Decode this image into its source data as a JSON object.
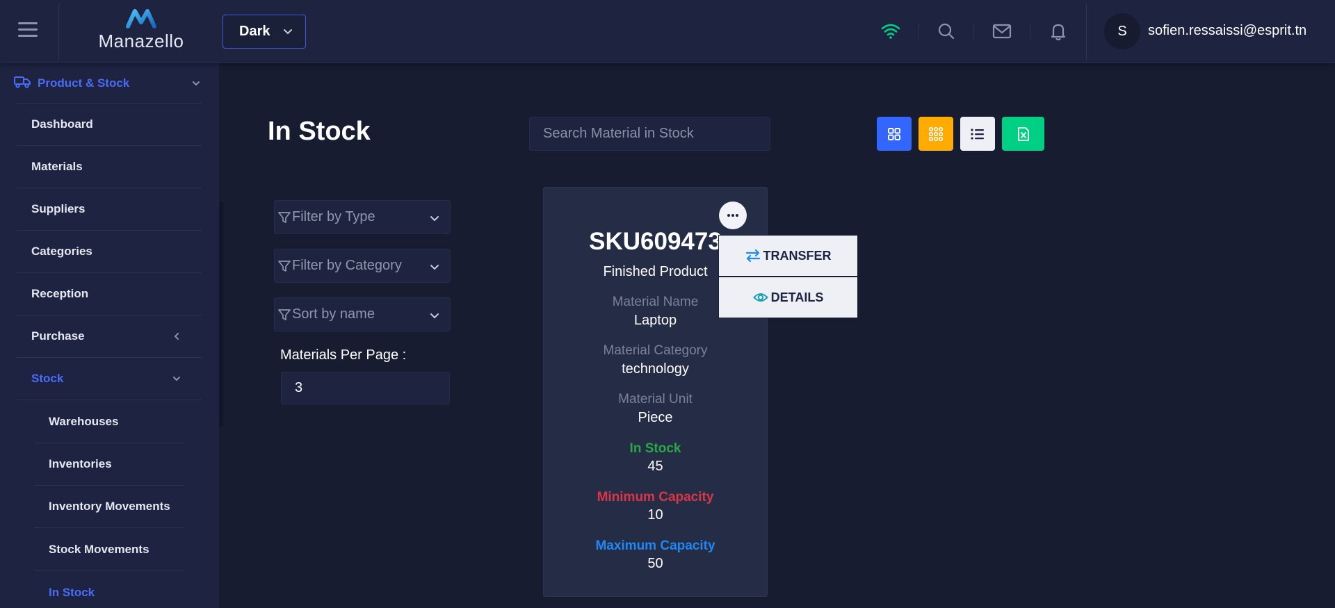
{
  "header": {
    "logo_text": "Manazello",
    "theme_select": "Dark",
    "user_initial": "S",
    "user_email": "sofien.ressaissi@esprit.tn"
  },
  "sidebar": {
    "section": "Product & Stock",
    "items": [
      {
        "label": "Dashboard"
      },
      {
        "label": "Materials"
      },
      {
        "label": "Suppliers"
      },
      {
        "label": "Categories"
      },
      {
        "label": "Reception"
      },
      {
        "label": "Purchase"
      },
      {
        "label": "Stock"
      }
    ],
    "stock_sub": [
      {
        "label": "Warehouses"
      },
      {
        "label": "Inventories"
      },
      {
        "label": "Inventory Movements"
      },
      {
        "label": "Stock Movements"
      },
      {
        "label": "In Stock"
      }
    ]
  },
  "main": {
    "title": "In Stock",
    "search_placeholder": "Search Material in Stock",
    "filters": {
      "type": "Filter by Type",
      "category": "Filter by Category",
      "sort": "Sort by name"
    },
    "per_page_label": "Materials Per Page :",
    "per_page_value": "3"
  },
  "card": {
    "sku": "SKU609473",
    "type": "Finished Product",
    "name_label": "Material Name",
    "name": "Laptop",
    "category_label": "Material Category",
    "category": "technology",
    "unit_label": "Material Unit",
    "unit": "Piece",
    "in_stock_label": "In Stock",
    "in_stock": "45",
    "min_label": "Minimum Capacity",
    "min": "10",
    "max_label": "Maximum Capacity",
    "max": "50"
  },
  "card_menu": {
    "transfer": "TRANSFER",
    "details": "DETAILS"
  },
  "colors": {
    "accent": "#4a6cf7",
    "view_grid": "#3366ff",
    "view_apps": "#ffab00",
    "view_list": "#eef0f6",
    "view_excel": "#00d084",
    "in_stock": "#28a745",
    "min_capacity": "#dc3545",
    "max_capacity": "#1e88f5"
  }
}
